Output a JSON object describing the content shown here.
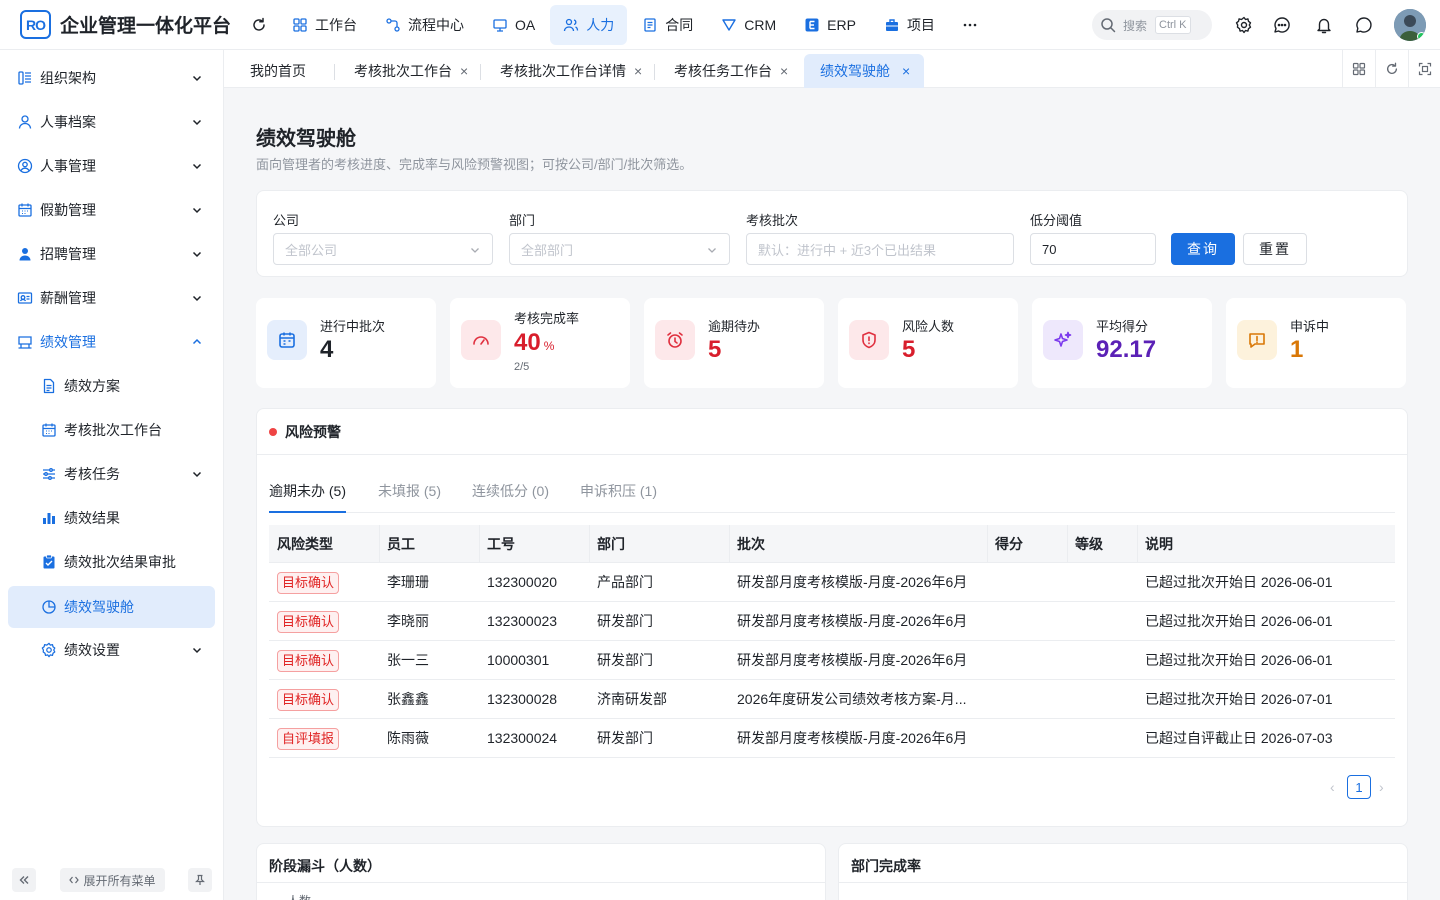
{
  "header": {
    "logo_text": "RO",
    "app_title": "企业管理一体化平台",
    "nav": [
      {
        "label": "工作台",
        "icon": "grid-icon"
      },
      {
        "label": "流程中心",
        "icon": "flow-icon"
      },
      {
        "label": "OA",
        "icon": "oa-icon"
      },
      {
        "label": "人力",
        "icon": "people-icon"
      },
      {
        "label": "合同",
        "icon": "contract-icon"
      },
      {
        "label": "CRM",
        "icon": "crm-icon"
      },
      {
        "label": "ERP",
        "icon": "erp-icon"
      },
      {
        "label": "项目",
        "icon": "project-icon"
      }
    ],
    "active_nav": "人力",
    "search_placeholder": "搜索",
    "search_shortcut": "Ctrl K"
  },
  "sidebar": {
    "items": [
      {
        "label": "组织架构",
        "icon": "org-icon"
      },
      {
        "label": "人事档案",
        "icon": "user-icon"
      },
      {
        "label": "人事管理",
        "icon": "user-circle-icon"
      },
      {
        "label": "假勤管理",
        "icon": "calendar-icon"
      },
      {
        "label": "招聘管理",
        "icon": "person-icon"
      },
      {
        "label": "薪酬管理",
        "icon": "salary-icon"
      },
      {
        "label": "绩效管理",
        "icon": "performance-icon"
      }
    ],
    "sub_items": [
      {
        "label": "绩效方案",
        "icon": "document-icon"
      },
      {
        "label": "考核批次工作台",
        "icon": "calendar-icon"
      },
      {
        "label": "考核任务",
        "icon": "sliders-icon"
      },
      {
        "label": "绩效结果",
        "icon": "bar-chart-icon"
      },
      {
        "label": "绩效批次结果审批",
        "icon": "clipboard-check-icon"
      },
      {
        "label": "绩效驾驶舱",
        "icon": "pie-icon"
      },
      {
        "label": "绩效设置",
        "icon": "gear-icon"
      }
    ],
    "expand_all_label": "展开所有菜单"
  },
  "tabs": [
    {
      "label": "我的首页",
      "closable": false
    },
    {
      "label": "考核批次工作台",
      "closable": true
    },
    {
      "label": "考核批次工作台详情",
      "closable": true
    },
    {
      "label": "考核任务工作台",
      "closable": true
    },
    {
      "label": "绩效驾驶舱",
      "closable": true
    }
  ],
  "active_tab": "绩效驾驶舱",
  "page": {
    "title": "绩效驾驶舱",
    "description": "面向管理者的考核进度、完成率与风险预警视图；可按公司/部门/批次筛选。"
  },
  "filters": {
    "company": {
      "label": "公司",
      "placeholder": "全部公司"
    },
    "department": {
      "label": "部门",
      "placeholder": "全部部门"
    },
    "batch": {
      "label": "考核批次",
      "placeholder": "默认：进行中 + 近3个已出结果"
    },
    "threshold": {
      "label": "低分阈值",
      "value": "70"
    },
    "query_label": "查询",
    "reset_label": "重置"
  },
  "stats": [
    {
      "label": "进行中批次",
      "value": "4",
      "color": "#1f2329",
      "icon": "calendar-icon",
      "bg": "#e5eefc",
      "fg": "#1a6fe0"
    },
    {
      "label": "考核完成率",
      "value": "40",
      "unit": "%",
      "sub": "2/5",
      "color": "#d81e2c",
      "icon": "gauge-icon",
      "bg": "#fde8ea",
      "fg": "#e0303f"
    },
    {
      "label": "逾期待办",
      "value": "5",
      "color": "#d81e2c",
      "icon": "alarm-icon",
      "bg": "#fde8ea",
      "fg": "#e0303f"
    },
    {
      "label": "风险人数",
      "value": "5",
      "color": "#d81e2c",
      "icon": "shield-alert-icon",
      "bg": "#fde8ea",
      "fg": "#e0303f"
    },
    {
      "label": "平均得分",
      "value": "92.17",
      "color": "#5b21b6",
      "icon": "sparkle-icon",
      "bg": "#eee8fc",
      "fg": "#7c3aed"
    },
    {
      "label": "申诉中",
      "value": "1",
      "color": "#d97706",
      "icon": "message-alert-icon",
      "bg": "#fdf2dc",
      "fg": "#d97706"
    }
  ],
  "risk": {
    "title": "风险预警",
    "tabs": [
      "逾期未办 (5)",
      "未填报 (5)",
      "连续低分 (0)",
      "申诉积压 (1)"
    ],
    "active_tab": "逾期未办 (5)",
    "columns": [
      "风险类型",
      "员工",
      "工号",
      "部门",
      "批次",
      "得分",
      "等级",
      "说明"
    ],
    "rows": [
      [
        "目标确认",
        "李珊珊",
        "132300020",
        "产品部门",
        "研发部月度考核模版-月度-2026年6月",
        "",
        "",
        "已超过批次开始日 2026-06-01"
      ],
      [
        "目标确认",
        "李晓丽",
        "132300023",
        "研发部门",
        "研发部月度考核模版-月度-2026年6月",
        "",
        "",
        "已超过批次开始日 2026-06-01"
      ],
      [
        "目标确认",
        "张一三",
        "10000301",
        "研发部门",
        "研发部月度考核模版-月度-2026年6月",
        "",
        "",
        "已超过批次开始日 2026-06-01"
      ],
      [
        "目标确认",
        "张鑫鑫",
        "132300028",
        "济南研发部",
        "2026年度研发公司绩效考核方案-月...",
        "",
        "",
        "已超过批次开始日 2026-07-01"
      ],
      [
        "自评填报",
        "陈雨薇",
        "132300024",
        "研发部门",
        "研发部月度考核模版-月度-2026年6月",
        "",
        "",
        "已超过自评截止日 2026-07-03"
      ]
    ],
    "page": "1"
  },
  "bottom": {
    "funnel_title": "阶段漏斗（人数）",
    "funnel_sub": "人数",
    "dept_title": "部门完成率"
  }
}
